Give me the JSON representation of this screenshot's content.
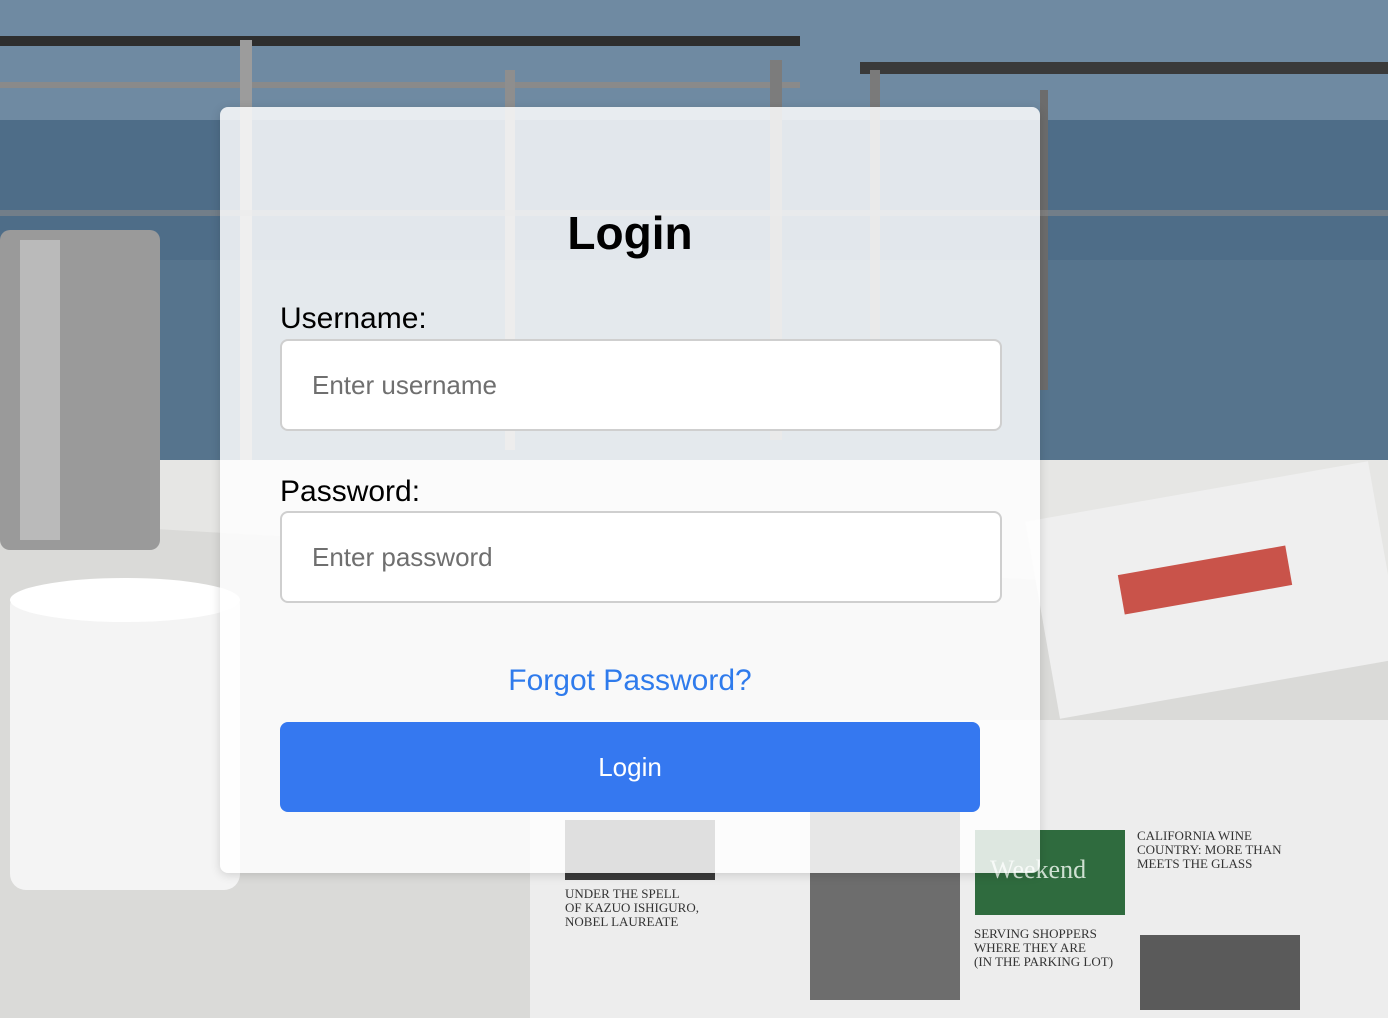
{
  "login_form": {
    "title": "Login",
    "username_label": "Username:",
    "username_placeholder": "Enter username",
    "username_value": "",
    "password_label": "Password:",
    "password_placeholder": "Enter password",
    "password_value": "",
    "forgot_password_link": "Forgot Password?",
    "submit_label": "Login"
  },
  "colors": {
    "accent": "#3578f0",
    "link": "#2f7bec",
    "card_background": "#ffffff"
  }
}
